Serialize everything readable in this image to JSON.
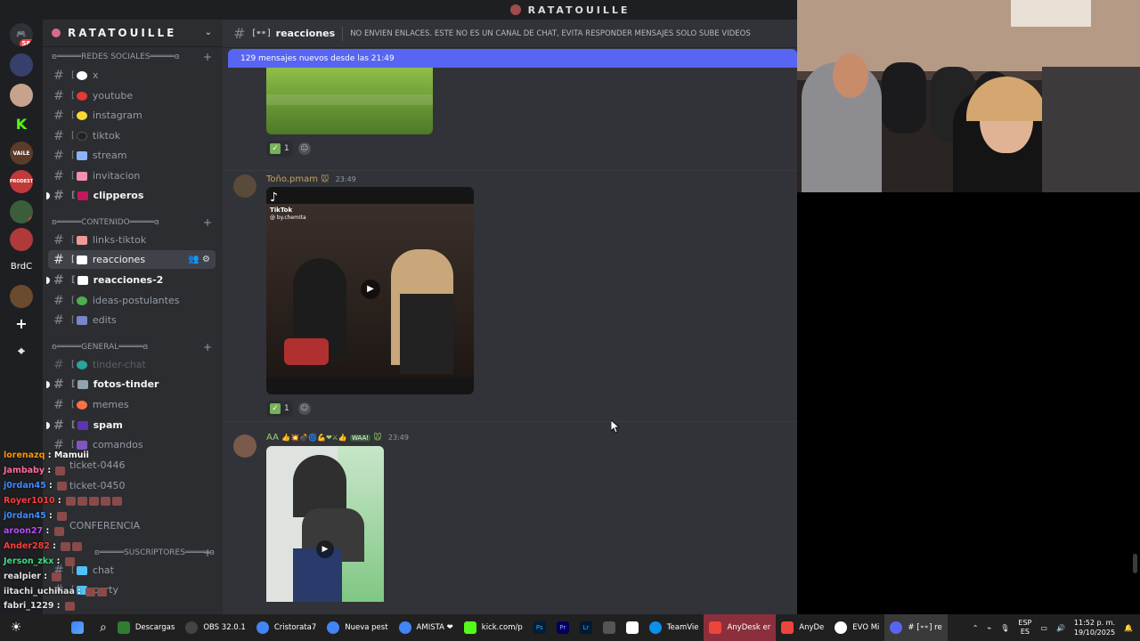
{
  "window": {
    "title": "RATATOUILLE"
  },
  "server": {
    "name": "RATATOUILLE"
  },
  "rail": [
    {
      "label": "",
      "badge": "582",
      "color": "#2f3136"
    },
    {
      "label": "",
      "color": "#37406b"
    },
    {
      "label": "",
      "color": "#c7a38d"
    },
    {
      "label": "K",
      "color": "#1e1f22"
    },
    {
      "label": "VAILE",
      "color": "#5b3b2a"
    },
    {
      "label": "PRODEST",
      "color": "#c03a3a"
    },
    {
      "label": "",
      "badge": "2",
      "color": "#3a5e3a"
    },
    {
      "label": "",
      "color": "#b03a3a"
    },
    {
      "label": "BrdC",
      "color": "#1e1f22"
    },
    {
      "label": "",
      "color": "#6b4b2e"
    },
    {
      "label": "+",
      "color": "#313338"
    },
    {
      "label": "⌖",
      "color": "#313338"
    }
  ],
  "categories": [
    {
      "label": "ʚ═════REDES SOCIALES═════ɞ"
    },
    {
      "label": "ʚ═════CONTENIDO═════ɞ"
    },
    {
      "label": "ʚ═════GENERAL═════ɞ"
    },
    {
      "label": "ʚ═════SUSCRIPTORES═════ɞ"
    }
  ],
  "channels": [
    {
      "label": "x",
      "emo": "#ffffff"
    },
    {
      "label": "youtube",
      "emo": "#e53935"
    },
    {
      "label": "instagram",
      "emo": "#fdd835"
    },
    {
      "label": "tiktok",
      "emo": "#222222"
    },
    {
      "label": "stream",
      "emo": "#8ab4f8"
    },
    {
      "label": "invitacion",
      "emo": "#f48fb1"
    },
    {
      "label": "clipperos",
      "emo": "#c2185b"
    },
    {
      "label": "links-tiktok",
      "emo": "#ef9a9a"
    },
    {
      "label": "reacciones",
      "emo": "#ffffff"
    },
    {
      "label": "reacciones-2",
      "emo": "#ffffff"
    },
    {
      "label": "ideas-postulantes",
      "emo": "#4caf50"
    },
    {
      "label": "edits",
      "emo": "#7986cb"
    },
    {
      "label": "tinder-chat",
      "emo": "#26a69a"
    },
    {
      "label": "fotos-tinder",
      "emo": "#90a4ae"
    },
    {
      "label": "memes",
      "emo": "#ff7043"
    },
    {
      "label": "spam",
      "emo": "#5e35b1"
    },
    {
      "label": "comandos",
      "emo": "#7e57c2"
    },
    {
      "label": "ticket-0446",
      "emo": "#888888"
    },
    {
      "label": "ticket-0450",
      "emo": "#888888"
    },
    {
      "label": "CONFERENCIA",
      "emo": "#888888"
    },
    {
      "label": "chat",
      "emo": "#4fc3f7"
    },
    {
      "label": "party",
      "emo": "#4fc3f7"
    }
  ],
  "header": {
    "channel": "reacciones",
    "topic": "NO ENVIEN ENLACES. ESTE NO ES UN CANAL DE CHAT, EVITA RESPONDER MENSAJES SOLO SUBE VIDEOS"
  },
  "new_messages": "129 mensajes nuevos desde las 21:49",
  "messages": [
    {
      "author": "",
      "time": "",
      "reaction_count": "1"
    },
    {
      "author": "Toño.pmam",
      "time": "23:49",
      "reaction_count": "1",
      "tiktok": "TikTok",
      "tiktok_user": "@ by.chemita"
    },
    {
      "author": "AA",
      "tag": "WAA!",
      "time": "23:49"
    }
  ],
  "stream_chat": [
    {
      "user": "lorenazq",
      "msg": "Mamuii",
      "color": "#ff9800"
    },
    {
      "user": "Jambaby",
      "msg": "",
      "color": "#ff6b9d"
    },
    {
      "user": "j0rdan45",
      "msg": "",
      "color": "#3d8bff"
    },
    {
      "user": "Royer1010",
      "msg": "",
      "color": "#ff3b3b"
    },
    {
      "user": "j0rdan45",
      "msg": "",
      "color": "#3d8bff"
    },
    {
      "user": "aroon27",
      "msg": "",
      "color": "#b44dff"
    },
    {
      "user": "Ander282",
      "msg": "",
      "color": "#ff3b3b"
    },
    {
      "user": "Jerson_zkx",
      "msg": "",
      "color": "#3ddc84"
    },
    {
      "user": "realpier",
      "msg": "",
      "color": "#e0e0e0"
    },
    {
      "user": "iitachi_uchihaa",
      "msg": "",
      "color": "#e0e0e0"
    },
    {
      "user": "fabri_1229",
      "msg": "",
      "color": "#e0e0e0"
    }
  ],
  "taskbar": [
    {
      "label": "",
      "color": "#3b82f6"
    },
    {
      "label": "",
      "color": "#202020"
    },
    {
      "label": "Descargas",
      "color": "#2e7d32"
    },
    {
      "label": "OBS 32.0.1",
      "color": "#444444"
    },
    {
      "label": "Cristorata7",
      "color": "#4285f4"
    },
    {
      "label": "Nueva pest",
      "color": "#4285f4"
    },
    {
      "label": "AMISTA ❤",
      "color": "#4285f4"
    },
    {
      "label": "kick.com/p",
      "color": "#53fc18"
    },
    {
      "label": "",
      "color": "#31a8ff"
    },
    {
      "label": "",
      "color": "#9999ff"
    },
    {
      "label": "",
      "color": "#1473e6"
    },
    {
      "label": "",
      "color": "#555555"
    },
    {
      "label": "",
      "color": "#ffffff"
    },
    {
      "label": "TeamVie",
      "color": "#0e8ee9"
    },
    {
      "label": "AnyDesk er",
      "color": "#ef443b"
    },
    {
      "label": "AnyDe",
      "color": "#ef443b"
    },
    {
      "label": "EVO Mi",
      "color": "#ffffff"
    },
    {
      "label": "# [👓] re",
      "color": "#5865f2"
    }
  ],
  "tray": {
    "lang": "ESP",
    "lang2": "ES",
    "time": "11:52 p. m.",
    "date": "19/10/2025"
  },
  "accent": "#5865f2"
}
